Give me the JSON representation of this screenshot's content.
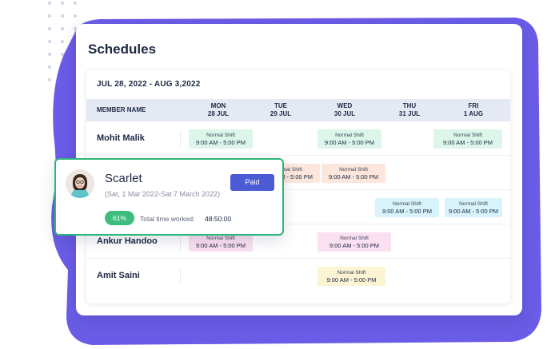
{
  "brand_colors": {
    "blob": "#6b5ce7",
    "paid": "#4a5bd4",
    "popup_border": "#2fb57a",
    "percent_badge": "#3dbd7d"
  },
  "schedule": {
    "title": "Schedules",
    "date_range": "JUL 28, 2022 - AUG 3,2022",
    "member_header": "MEMBER NAME",
    "days": [
      {
        "day": "MON",
        "date": "28 JUL"
      },
      {
        "day": "TUE",
        "date": "29 JUL"
      },
      {
        "day": "WED",
        "date": "30 JUL"
      },
      {
        "day": "THU",
        "date": "31 JUL"
      },
      {
        "day": "FRI",
        "date": "1 AUG"
      }
    ],
    "rows": [
      {
        "name": "Mohit Malik"
      },
      {
        "name": ""
      },
      {
        "name": ""
      },
      {
        "name": "Ankur Handoo"
      },
      {
        "name": "Amit Saini"
      }
    ],
    "shift_label": "Normal Shift",
    "shift_time": "9:00 AM - 5:00 PM"
  },
  "popup": {
    "name": "Scarlet",
    "dates": "(Sat, 1 Mar 2022-Sat 7 March 2022)",
    "paid_label": "Paid",
    "percent": "61%",
    "total_label": "Total time worked:",
    "total_value": "48:50:00",
    "avatar_icon": "user-photo"
  }
}
